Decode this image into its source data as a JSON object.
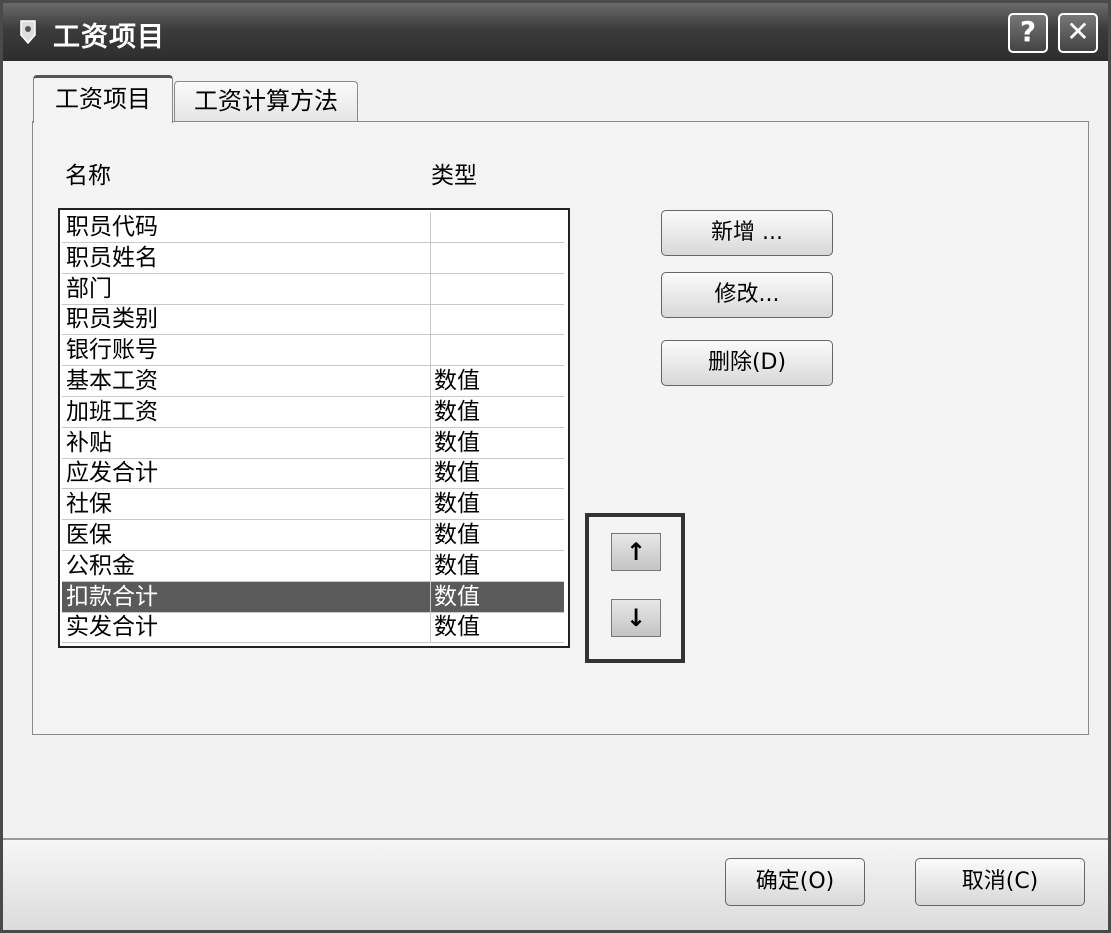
{
  "window": {
    "title": "工资项目",
    "help_label": "?",
    "close_label": "✕"
  },
  "tabs": [
    {
      "label": "工资项目",
      "active": true
    },
    {
      "label": "工资计算方法",
      "active": false
    }
  ],
  "list": {
    "columns": [
      "名称",
      "类型"
    ],
    "rows": [
      {
        "name": "职员代码",
        "type": ""
      },
      {
        "name": "职员姓名",
        "type": ""
      },
      {
        "name": "部门",
        "type": ""
      },
      {
        "name": "职员类别",
        "type": ""
      },
      {
        "name": "银行账号",
        "type": ""
      },
      {
        "name": "基本工资",
        "type": "数值"
      },
      {
        "name": "加班工资",
        "type": "数值"
      },
      {
        "name": "补贴",
        "type": "数值"
      },
      {
        "name": "应发合计",
        "type": "数值"
      },
      {
        "name": "社保",
        "type": "数值"
      },
      {
        "name": "医保",
        "type": "数值"
      },
      {
        "name": "公积金",
        "type": "数值"
      },
      {
        "name": "扣款合计",
        "type": "数值",
        "selected": true
      },
      {
        "name": "实发合计",
        "type": "数值"
      }
    ]
  },
  "buttons": {
    "add": "新增 ...",
    "edit": "修改...",
    "delete": "删除(D)",
    "move_up": "↑",
    "move_down": "↓",
    "ok": "确定(O)",
    "cancel": "取消(C)"
  },
  "colors": {
    "selected_row": "#5a5a5a",
    "titlebar": "#3c3c3c"
  }
}
